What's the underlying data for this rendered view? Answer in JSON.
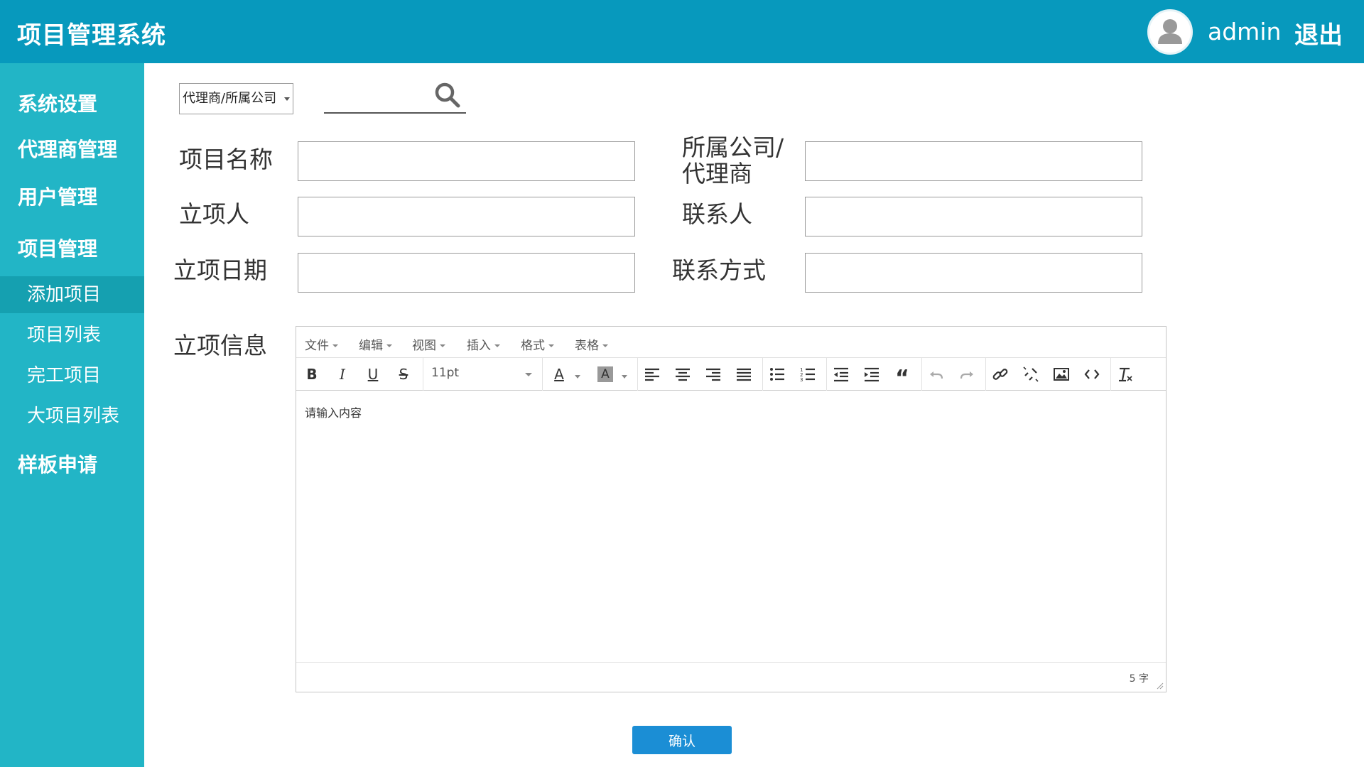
{
  "header": {
    "title": "项目管理系统",
    "username": "admin",
    "logout_label": "退出"
  },
  "sidebar": {
    "groups": [
      {
        "label": "系统设置"
      },
      {
        "label": "代理商管理"
      },
      {
        "label": "用户管理"
      },
      {
        "label": "项目管理"
      },
      {
        "label": "样板申请"
      }
    ],
    "project_items": [
      {
        "label": "添加项目",
        "active": true
      },
      {
        "label": "项目列表"
      },
      {
        "label": "完工项目"
      },
      {
        "label": "大项目列表"
      }
    ]
  },
  "search": {
    "select_value": "代理商/所属公司",
    "input_value": ""
  },
  "form": {
    "project_name_label": "项目名称",
    "company_label_line1": "所属公司/",
    "company_label_line2": "代理商",
    "initiator_label": "立项人",
    "contact_label": "联系人",
    "date_label": "立项日期",
    "contact_method_label": "联系方式",
    "info_label": "立项信息"
  },
  "editor": {
    "menus": [
      "文件",
      "编辑",
      "视图",
      "插入",
      "格式",
      "表格"
    ],
    "font_size": "11pt",
    "placeholder": "请输入内容",
    "word_count": "5 字"
  },
  "confirm_label": "确认",
  "colors": {
    "header_bg": "#0799bd",
    "sidebar_bg": "#22b5c6",
    "sidebar_active": "#15a0b0",
    "button_bg": "#1b8ed5"
  }
}
